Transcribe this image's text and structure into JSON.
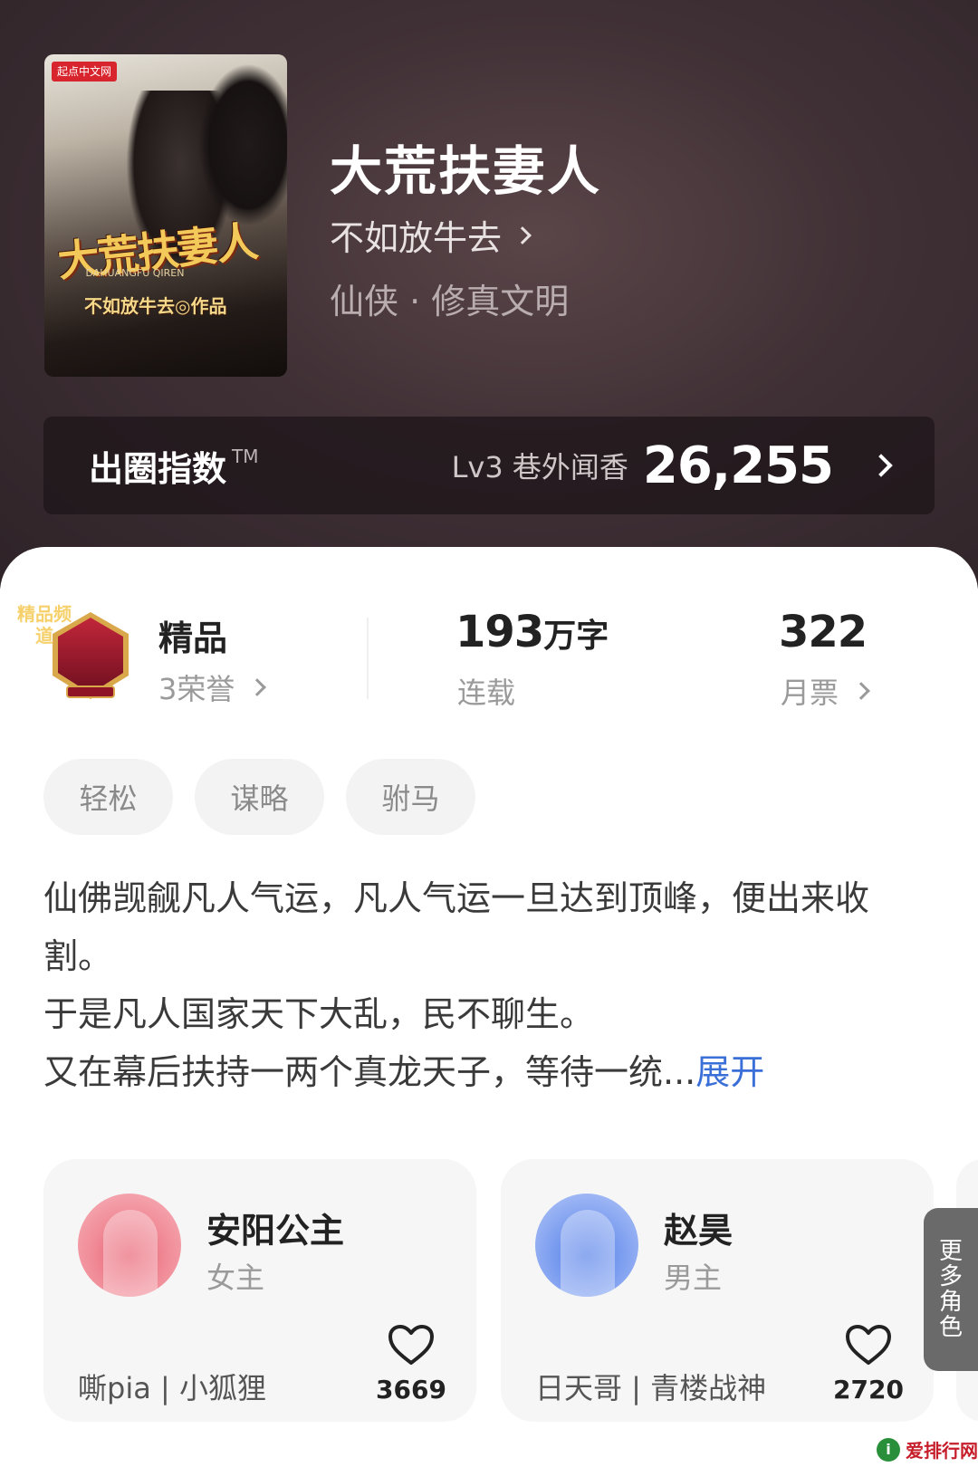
{
  "book": {
    "title": "大荒扶妻人",
    "author": "不如放牛去",
    "genre": "仙侠 · 修真文明",
    "cover": {
      "publisher_logo": "起点中文网",
      "title": "大荒扶妻人",
      "pinyin": "DAHUANGFU QIREN",
      "author_line": "不如放牛去◎作品"
    }
  },
  "index": {
    "label": "出圈指数",
    "tm": "TM",
    "level": "Lv3 巷外闻香",
    "value": "26,255"
  },
  "stats": {
    "badge_text": "精品频道",
    "honor_main": "精品",
    "honor_sub": "3荣誉",
    "words_num": "193",
    "words_unit": "万字",
    "words_sub": "连载",
    "votes_main": "322",
    "votes_sub": "月票"
  },
  "tags": [
    "轻松",
    "谋略",
    "驸马"
  ],
  "description": {
    "text": "仙佛觊觎凡人气运，凡人气运一旦达到顶峰，便出来收割。\n于是凡人国家天下大乱，民不聊生。\n又在幕后扶持一两个真龙天子，等待一统...",
    "expand_label": "展开"
  },
  "roles": [
    {
      "name": "安阳公主",
      "type": "女主",
      "cv": "嘶pia | 小狐狸",
      "likes": "3669",
      "color": "#f08a96"
    },
    {
      "name": "赵昊",
      "type": "男主",
      "cv": "日天哥 | 青楼战神",
      "likes": "2720",
      "color": "#7e9ff0"
    }
  ],
  "more_roles_label": [
    "更",
    "多",
    "角",
    "色"
  ],
  "watermark": {
    "icon": "i",
    "text": "爱排行网"
  }
}
